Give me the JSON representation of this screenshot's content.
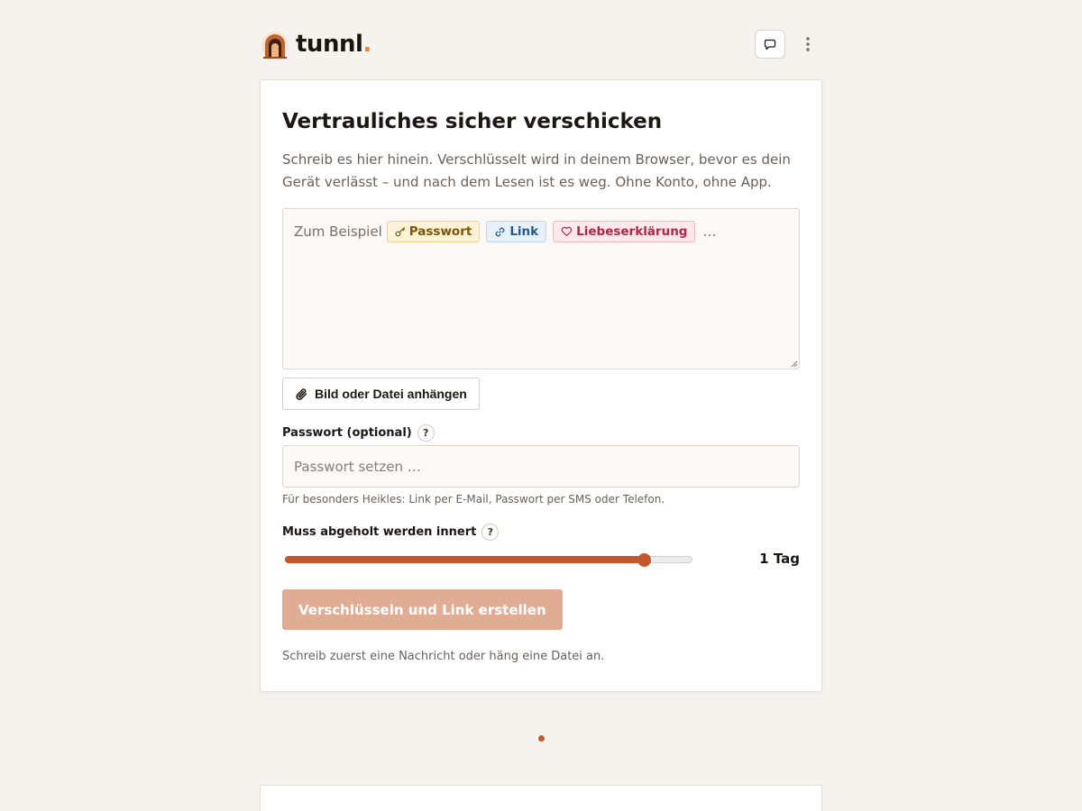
{
  "brand": {
    "name": "tunnl",
    "dot": ".",
    "accent": "#e8843f"
  },
  "header": {
    "feedback_icon": "speech-bubble-icon",
    "menu_icon": "vertical-dots-icon"
  },
  "form": {
    "title": "Vertrauliches sicher verschicken",
    "intro": "Schreib es hier hinein. Verschlüsselt wird in deinem Browser, bevor es dein Gerät verlässt – und nach dem Lesen ist es weg. Ohne Konto, ohne App.",
    "message": {
      "placeholder_prefix": "Zum Beispiel",
      "examples": [
        "Passwort",
        "Link",
        "Liebeserklärung"
      ],
      "suffix": "…"
    },
    "attach_label": "Bild oder Datei anhängen",
    "password": {
      "label": "Passwort (optional)",
      "help": "?",
      "placeholder": "Passwort setzen …",
      "value": "",
      "hint": "Für besonders Heikles: Link per E-Mail, Passwort per SMS oder Telefon."
    },
    "expiry": {
      "label": "Muss abgeholt werden innert",
      "help": "?",
      "value_label": "1 Tag",
      "level": 0.88
    },
    "submit_label": "Verschlüsseln und Link erstellen",
    "status": "Schreib zuerst eine Nachricht oder häng eine Datei an."
  },
  "colors": {
    "primary": "#c2582c",
    "primary_disabled": "#e0ad94",
    "background": "#f6f3ef"
  }
}
